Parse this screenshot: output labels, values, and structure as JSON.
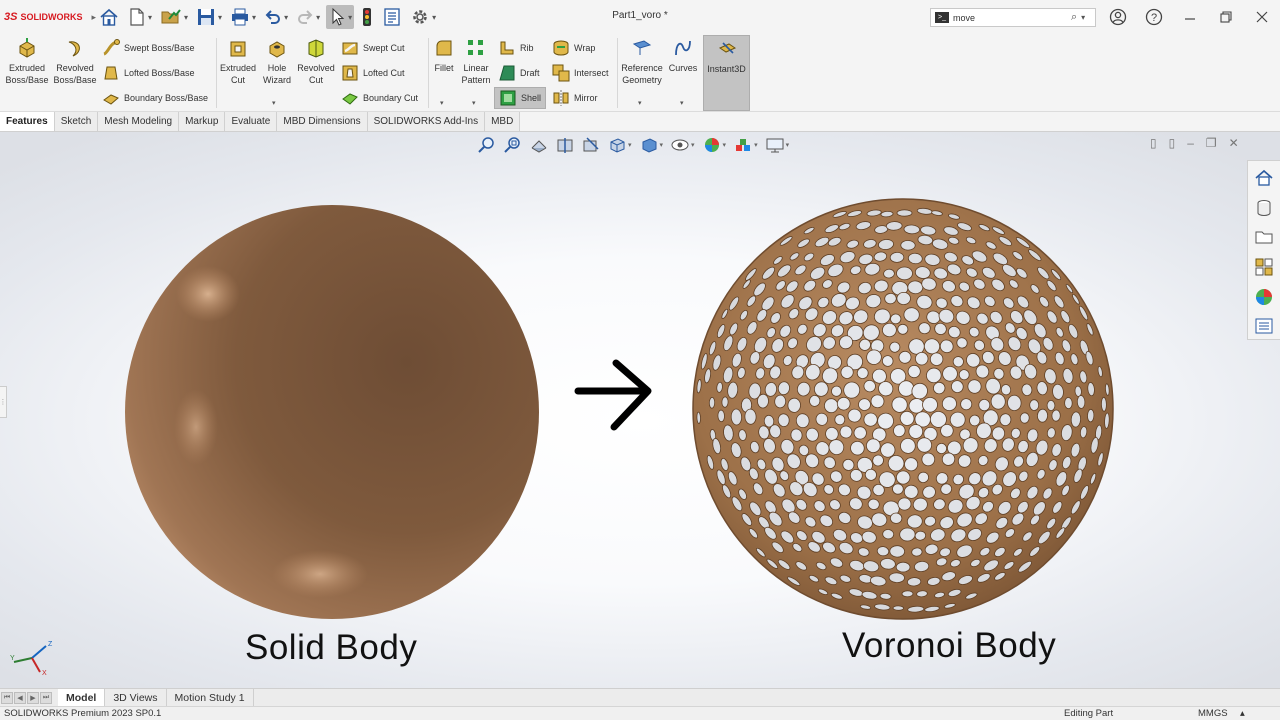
{
  "app": {
    "logo_mark": "3S",
    "logo_word": "SOLIDWORKS",
    "document_title": "Part1_voro *"
  },
  "quick_access": [
    {
      "name": "home-button",
      "icon": "home-icon"
    },
    {
      "name": "new-button",
      "icon": "new-document-icon"
    },
    {
      "name": "open-button",
      "icon": "open-icon"
    },
    {
      "name": "save-button",
      "icon": "save-icon"
    },
    {
      "name": "print-button",
      "icon": "print-icon"
    },
    {
      "name": "undo-button",
      "icon": "undo-icon"
    },
    {
      "name": "redo-button",
      "icon": "redo-icon"
    },
    {
      "name": "select-button",
      "icon": "select-arrow-icon"
    },
    {
      "name": "rebuild-button",
      "icon": "rebuild-traffic-light-icon"
    },
    {
      "name": "file-properties-button",
      "icon": "file-properties-icon"
    },
    {
      "name": "options-button",
      "icon": "gear-icon"
    }
  ],
  "search": {
    "value": "move",
    "prompt_icon": ">_"
  },
  "ribbon": {
    "extruded_boss": "Extruded\nBoss/Base",
    "revolved_boss": "Revolved\nBoss/Base",
    "swept_boss": "Swept Boss/Base",
    "lofted_boss": "Lofted Boss/Base",
    "boundary_boss": "Boundary Boss/Base",
    "extruded_cut": "Extruded\nCut",
    "hole_wizard": "Hole\nWizard",
    "revolved_cut": "Revolved\nCut",
    "swept_cut": "Swept Cut",
    "lofted_cut": "Lofted Cut",
    "boundary_cut": "Boundary Cut",
    "fillet": "Fillet",
    "linear_pattern": "Linear\nPattern",
    "rib": "Rib",
    "draft": "Draft",
    "shell": "Shell",
    "wrap": "Wrap",
    "intersect": "Intersect",
    "mirror": "Mirror",
    "reference_geometry": "Reference\nGeometry",
    "curves": "Curves",
    "instant3d": "Instant3D"
  },
  "tabs": [
    "Features",
    "Sketch",
    "Mesh Modeling",
    "Markup",
    "Evaluate",
    "MBD Dimensions",
    "SOLIDWORKS Add-Ins",
    "MBD"
  ],
  "active_tab": "Features",
  "viewport": {
    "left_label": "Solid Body",
    "right_label": "Voronoi Body",
    "arrow_icon": "right-arrow-icon",
    "body_color": "#8a5e3c",
    "triad_axes": {
      "x": "X",
      "y": "Y",
      "z": "Z"
    }
  },
  "bottom_tabs": [
    "Model",
    "3D Views",
    "Motion Study 1"
  ],
  "active_bottom_tab": "Model",
  "status": {
    "product": "SOLIDWORKS Premium 2023 SP0.1",
    "mode": "Editing Part",
    "units": "MMGS"
  }
}
